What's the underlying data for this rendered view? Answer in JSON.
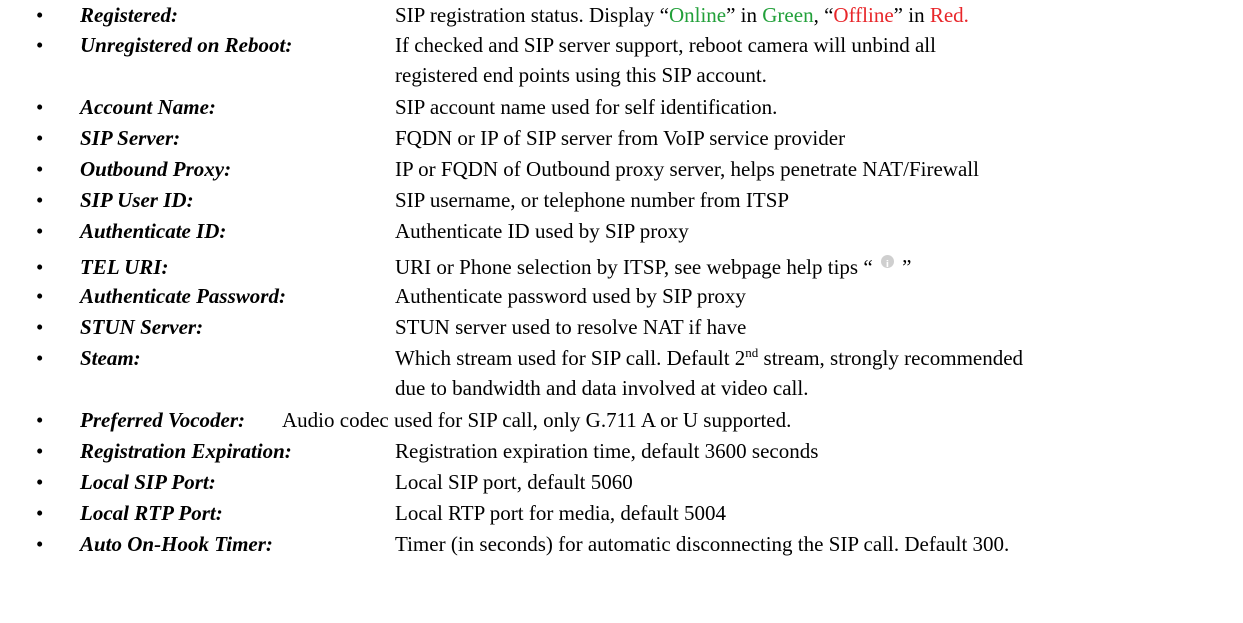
{
  "bullet": "•",
  "colors": {
    "green": "#22a03a",
    "red": "#e8262a"
  },
  "items": [
    {
      "term": "Registered:",
      "segments": [
        "SIP registration status. Display “",
        "Online",
        "” in ",
        "Green",
        ", “",
        "Offline",
        "” in ",
        "Red."
      ]
    },
    {
      "term": "Unregistered on Reboot:",
      "lines": [
        "If checked and SIP server support, reboot camera will unbind all",
        "registered end points using this SIP account."
      ]
    },
    {
      "term": "Account Name:",
      "lines": [
        "SIP account name used for self identification."
      ]
    },
    {
      "term": "SIP Server:",
      "lines": [
        "FQDN or IP of SIP server from VoIP service provider"
      ]
    },
    {
      "term": "Outbound Proxy:",
      "lines": [
        "IP or FQDN of Outbound proxy server, helps penetrate NAT/Firewall"
      ]
    },
    {
      "term": "SIP User ID:",
      "lines": [
        "SIP username, or telephone number from ITSP"
      ]
    },
    {
      "term": "Authenticate ID:",
      "lines": [
        "Authenticate ID used by SIP proxy"
      ]
    },
    {
      "term": "TEL URI:",
      "before_icon": "URI or Phone selection by ITSP, see webpage help tips “ ",
      "after_icon": " ”",
      "icon": "info-icon"
    },
    {
      "term": "Authenticate Password:",
      "lines": [
        "Authenticate password used by SIP proxy"
      ]
    },
    {
      "term": "STUN Server:",
      "lines": [
        "STUN server used to resolve NAT if have"
      ]
    },
    {
      "term": "Steam:",
      "line1_a": "Which stream used for SIP call. Default 2",
      "line1_sup": "nd",
      "line1_b": " stream, strongly recommended",
      "line2": "due to bandwidth and data involved at video call."
    },
    {
      "term": "Preferred Vocoder:",
      "lines": [
        "Audio codec used for SIP call, only G.711 A or U supported."
      ]
    },
    {
      "term": "Registration Expiration:",
      "lines": [
        "Registration expiration time, default 3600 seconds"
      ]
    },
    {
      "term": "Local SIP Port:",
      "lines": [
        "Local SIP port, default 5060"
      ]
    },
    {
      "term": "Local RTP Port:",
      "lines": [
        "Local RTP port for media, default 5004"
      ]
    },
    {
      "term": "Auto On-Hook Timer:",
      "lines": [
        "Timer (in seconds) for automatic disconnecting the SIP call. Default 300."
      ]
    }
  ]
}
